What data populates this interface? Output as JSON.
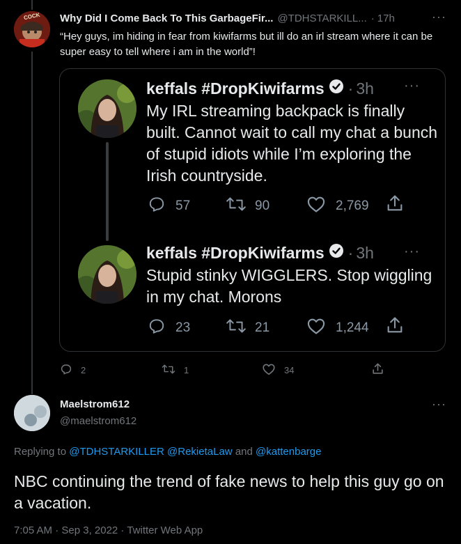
{
  "top_tweet": {
    "display_name": "Why Did I Come Back To This GarbageFir...",
    "handle": "@TDHSTARKILL...",
    "sep": "·",
    "time": "17h",
    "text": "“Hey guys, im hiding in fear from kiwifarms but ill do an irl stream where it can be super easy to tell where i am in the world”!",
    "avatar_badge": "COCK",
    "actions": {
      "replies": "2",
      "retweets": "1",
      "likes": "34"
    }
  },
  "quoted_1": {
    "display_name": "keffals #DropKiwifarms",
    "sep": "·",
    "time": "3h",
    "text": "My IRL streaming backpack is finally built. Cannot wait to call my chat a bunch of stupid idiots while I’m exploring the Irish countryside.",
    "actions": {
      "replies": "57",
      "retweets": "90",
      "likes": "2,769"
    }
  },
  "quoted_2": {
    "display_name": "keffals #DropKiwifarms",
    "sep": "·",
    "time": "3h",
    "text": "Stupid stinky WIGGLERS. Stop wiggling in my chat. Morons",
    "actions": {
      "replies": "23",
      "retweets": "21",
      "likes": "1,244"
    }
  },
  "main_tweet": {
    "display_name": "Maelstrom612",
    "handle": "@maelstrom612",
    "replying_prefix": "Replying to",
    "replying_1": "@TDHSTARKILLER",
    "replying_2": "@RekietaLaw",
    "replying_and": "and",
    "replying_3": "@kattenbarge",
    "text": "NBC continuing the trend of fake news to help this guy go on a vacation.",
    "meta": "7:05 AM · Sep 3, 2022 · Twitter Web App"
  },
  "colors": {
    "accent": "#1d9bf0",
    "muted": "#71767b",
    "text": "#e7e9ea",
    "border": "#2f3336"
  },
  "icons": [
    "more-icon",
    "verified-icon",
    "reply-icon",
    "retweet-icon",
    "like-icon",
    "share-icon",
    "default-avatar-icon"
  ]
}
